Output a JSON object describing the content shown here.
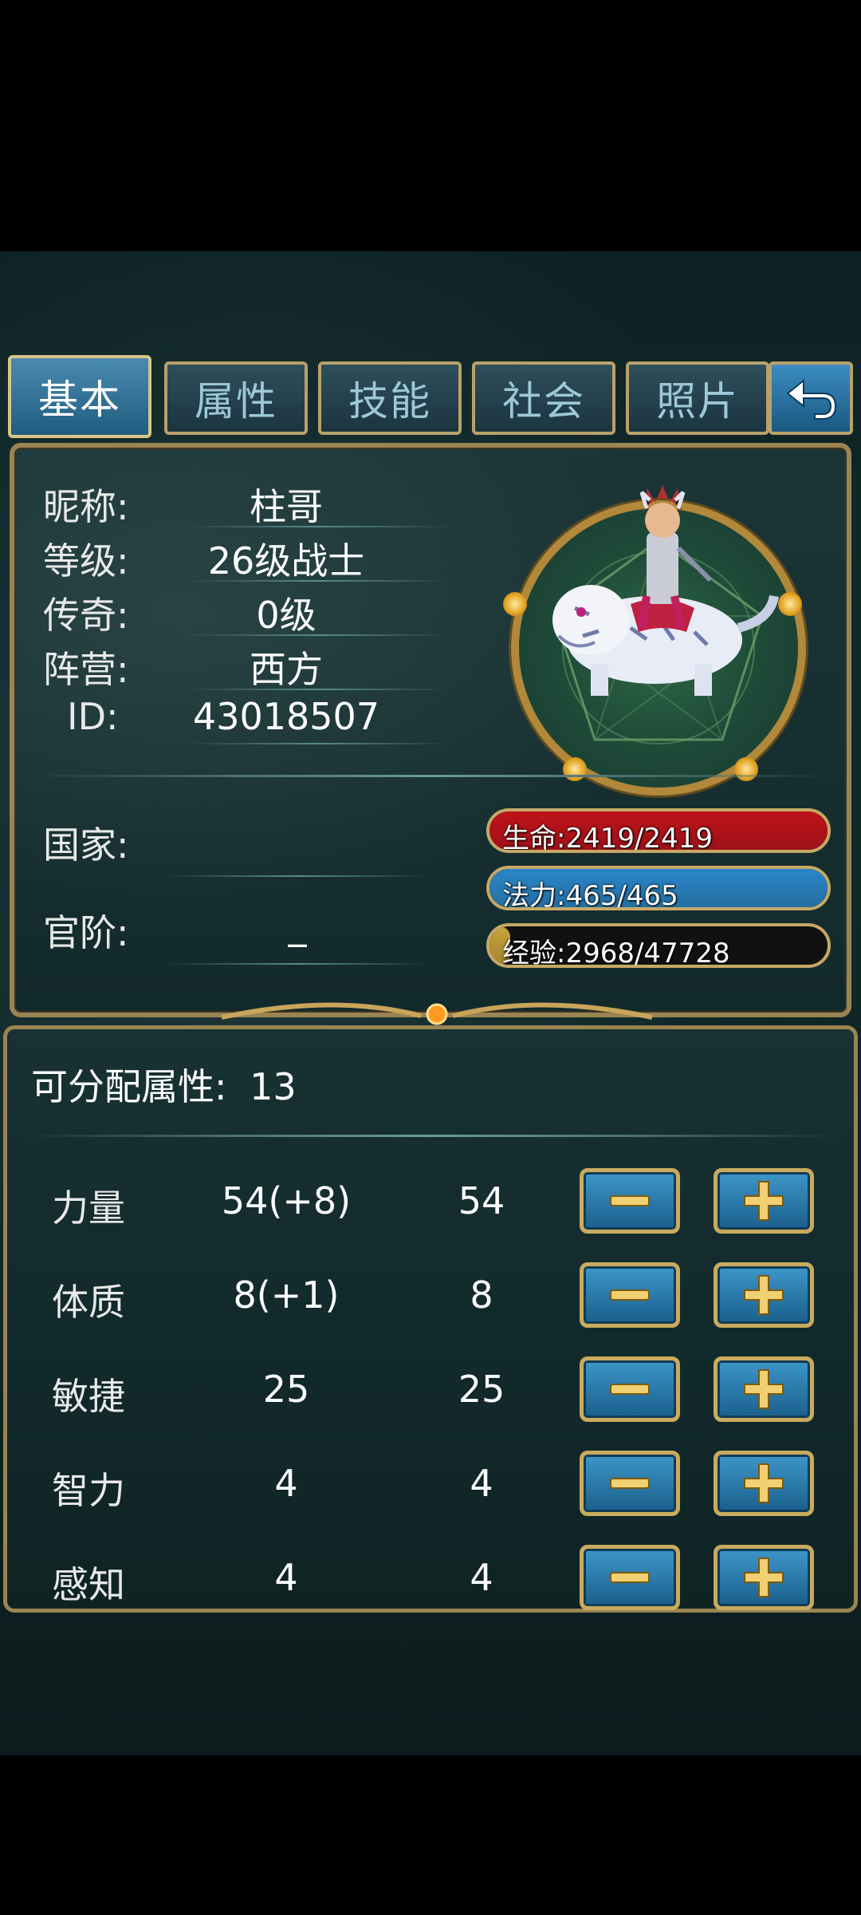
{
  "tabs": [
    "基本",
    "属性",
    "技能",
    "社会",
    "照片"
  ],
  "info": {
    "rows": [
      {
        "label": "昵称:",
        "value": "柱哥"
      },
      {
        "label": "等级:",
        "value": "26级战士"
      },
      {
        "label": "传奇:",
        "value": "0级"
      },
      {
        "label": "阵营:",
        "value": "西方"
      },
      {
        "label": "ID:",
        "value": "43018507"
      }
    ],
    "country_label": "国家:",
    "country_value": "",
    "rank_label": "官阶:",
    "rank_value": "_"
  },
  "bars": {
    "hp": {
      "text": "生命:2419/2419",
      "fraction": 1.0,
      "color": "#c0121a"
    },
    "mp": {
      "text": "法力:465/465",
      "fraction": 1.0,
      "color": "#2a86c8"
    },
    "exp": {
      "text": "经验:2968/47728",
      "fraction": 0.0622,
      "color": "#c9a23a"
    }
  },
  "attributes": {
    "points_label": "可分配属性:",
    "points_value": "13",
    "rows": [
      {
        "name": "力量",
        "current": "54(+8)",
        "base": "54"
      },
      {
        "name": "体质",
        "current": "8(+1)",
        "base": "8"
      },
      {
        "name": "敏捷",
        "current": "25",
        "base": "25"
      },
      {
        "name": "智力",
        "current": "4",
        "base": "4"
      },
      {
        "name": "感知",
        "current": "4",
        "base": "4"
      }
    ]
  },
  "icons": {
    "back": "back-arrow-icon",
    "minus": "minus-icon",
    "plus": "plus-icon"
  }
}
